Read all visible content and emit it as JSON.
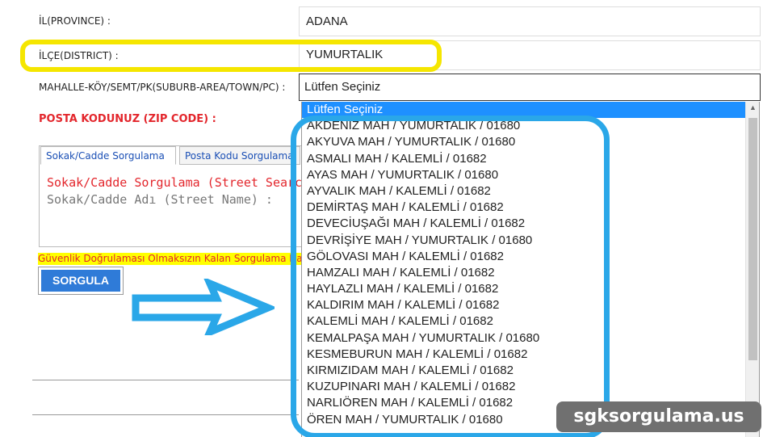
{
  "form": {
    "province_label": "İL(PROVINCE) :",
    "province_value": "ADANA",
    "district_label": "İLÇE(DISTRICT) :",
    "district_value": "YUMURTALIK",
    "suburb_label": "MAHALLE-KÖY/SEMT/PK(SUBURB-AREA/TOWN/PC) :",
    "suburb_value": "Lütfen Seçiniz",
    "zip_label": "POSTA KODUNUZ (ZIP CODE) :"
  },
  "tabs": [
    {
      "label": "Sokak/Cadde Sorgulama"
    },
    {
      "label": "Posta Kodu Sorgulama"
    }
  ],
  "street_panel": {
    "title": "Sokak/Cadde Sorgulama (Street Search)",
    "field_label": "Sokak/Cadde Adı (Street Name) :"
  },
  "warning_text": "Güvenlik Doğrulaması Olmaksızın Kalan Sorgulama Hakkı",
  "query_button": "SORGULA",
  "dropdown_options": [
    "Lütfen Seçiniz",
    "AKDENİZ MAH / YUMURTALIK / 01680",
    "AKYUVA MAH / YUMURTALIK / 01680",
    "ASMALI MAH / KALEMLİ / 01682",
    "AYAS MAH / YUMURTALIK / 01680",
    "AYVALIK MAH / KALEMLİ / 01682",
    "DEMİRTAŞ MAH / KALEMLİ / 01682",
    "DEVECİUŞAĞI MAH / KALEMLİ / 01682",
    "DEVRİŞİYE MAH / YUMURTALIK / 01680",
    "GÖLOVASI MAH / KALEMLİ / 01682",
    "HAMZALI MAH / KALEMLİ / 01682",
    "HAYLAZLI MAH / KALEMLİ / 01682",
    "KALDIRIM MAH / KALEMLİ / 01682",
    "KALEMLİ MAH / KALEMLİ / 01682",
    "KEMALPAŞA MAH / YUMURTALIK / 01680",
    "KESMEBURUN MAH / KALEMLİ / 01682",
    "KIRMIZIDAM MAH / KALEMLİ / 01682",
    "KUZUPINARI MAH / KALEMLİ / 01682",
    "NARLIÖREN MAH / KALEMLİ / 01682",
    "ÖREN MAH / YUMURTALIK / 01680"
  ],
  "watermark": "sgksorgulama.us",
  "colors": {
    "highlight_yellow": "#f5e600",
    "highlight_blue": "#2aa7e8",
    "selected_option": "#1e90ff",
    "zip_label": "#e3262c",
    "button": "#2f7bd8"
  },
  "icons": {
    "arrow": "right-arrow-icon",
    "scroll_up": "scroll-up-icon"
  }
}
